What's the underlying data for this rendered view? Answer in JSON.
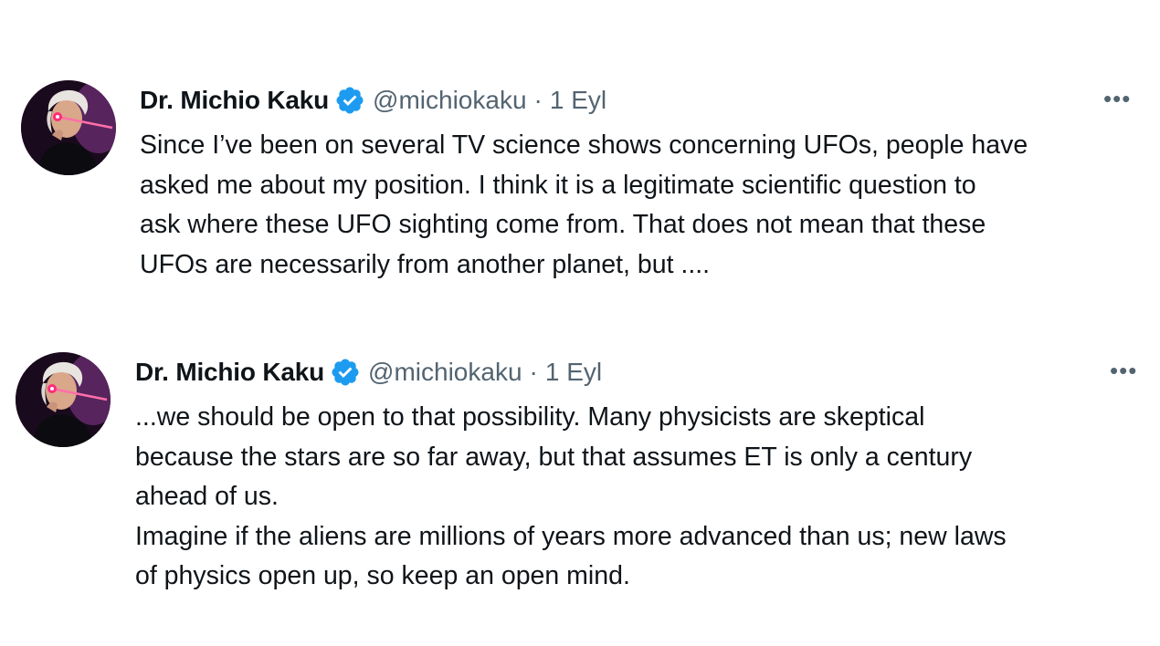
{
  "tweets": [
    {
      "author_name": "Dr. Michio Kaku",
      "handle": "@michiokaku",
      "separator": "·",
      "time": "1 Eyl",
      "more_icon": "more-dots-icon",
      "verified_icon": "verified-badge-icon",
      "verified_color": "#1d9bf0",
      "text": "Since I’ve been on several TV science shows concerning UFOs, people have\nasked me about my position. I think it is a legitimate scientific question to\nask where these UFO sighting come from. That does not mean that these\nUFOs are necessarily from another planet, but ...."
    },
    {
      "author_name": "Dr. Michio Kaku",
      "handle": "@michiokaku",
      "separator": "·",
      "time": "1 Eyl",
      "more_icon": "more-dots-icon",
      "verified_icon": "verified-badge-icon",
      "verified_color": "#1d9bf0",
      "text": "...we should be open to that possibility. Many physicists are skeptical\nbecause the stars are so far away, but that assumes ET is only a century\nahead of us.\nImagine if the  aliens are millions of years more advanced than us; new laws\nof physics open up, so keep an open mind."
    }
  ]
}
